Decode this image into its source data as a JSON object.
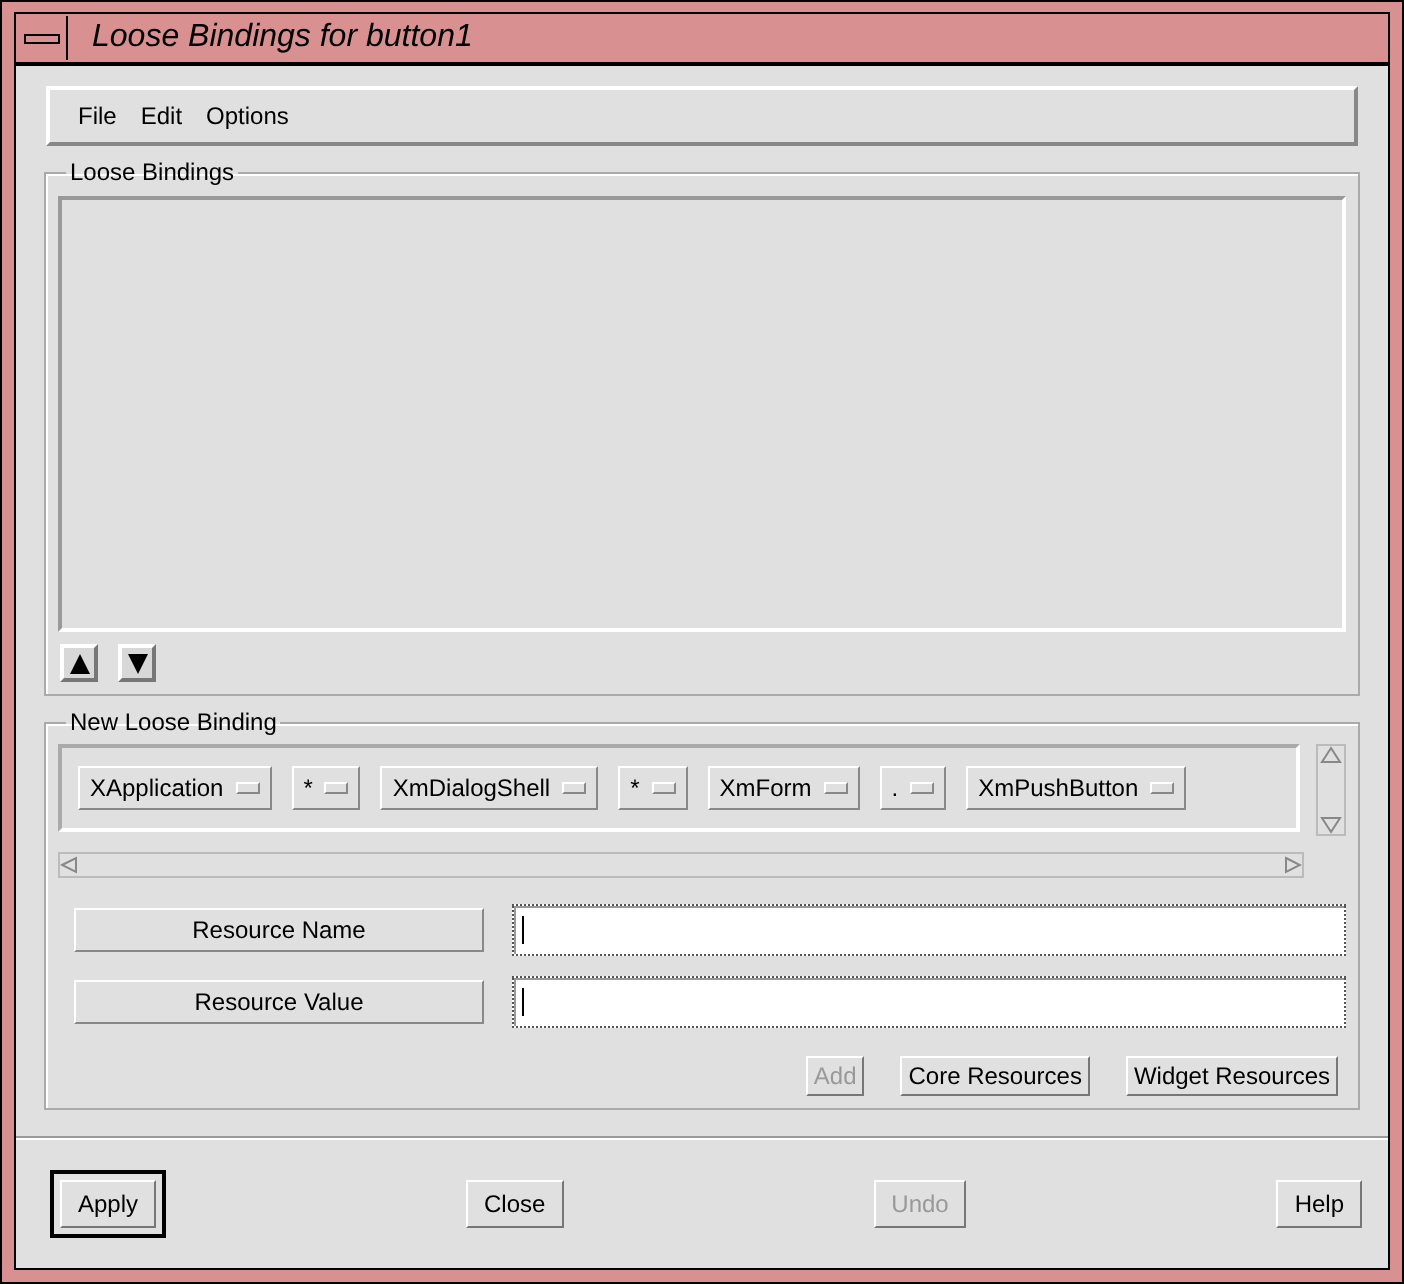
{
  "window": {
    "title": "Loose Bindings for button1"
  },
  "menu": [
    {
      "label": "File"
    },
    {
      "label": "Edit"
    },
    {
      "label": "Options"
    }
  ],
  "loose_bindings": {
    "title": "Loose Bindings"
  },
  "new_binding": {
    "title": "New Loose Binding",
    "parts": [
      {
        "label": "XApplication"
      },
      {
        "label": "*"
      },
      {
        "label": "XmDialogShell"
      },
      {
        "label": "*"
      },
      {
        "label": "XmForm"
      },
      {
        "label": "."
      },
      {
        "label": "XmPushButton"
      }
    ],
    "fields": [
      {
        "label": "Resource Name"
      },
      {
        "label": "Resource Value"
      }
    ],
    "actions": [
      {
        "label": "Add",
        "disabled": true
      },
      {
        "label": "Core Resources",
        "disabled": false
      },
      {
        "label": "Widget Resources",
        "disabled": false
      }
    ]
  },
  "buttons": [
    {
      "label": "Apply",
      "default": true,
      "disabled": false
    },
    {
      "label": "Close",
      "default": false,
      "disabled": false
    },
    {
      "label": "Undo",
      "default": false,
      "disabled": true
    },
    {
      "label": "Help",
      "default": false,
      "disabled": false
    }
  ]
}
